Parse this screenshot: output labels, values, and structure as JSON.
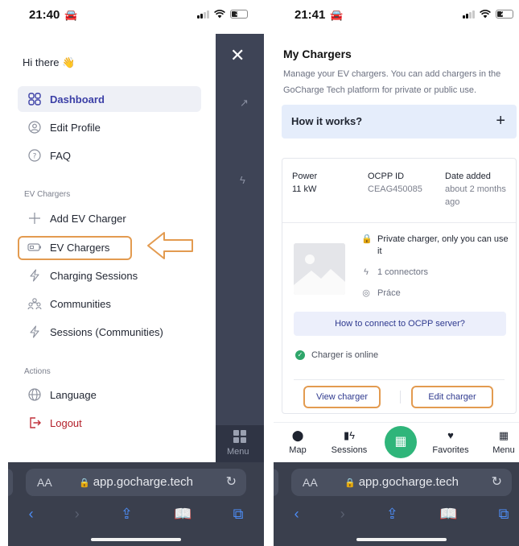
{
  "left": {
    "status": {
      "time": "21:40",
      "battery": "30"
    },
    "greeting": "Hi there",
    "greeting_emoji": "👋",
    "nav": {
      "dashboard": "Dashboard",
      "edit_profile": "Edit Profile",
      "faq": "FAQ"
    },
    "section_ev": "EV Chargers",
    "ev": {
      "add": "Add EV Charger",
      "chargers": "EV Chargers",
      "charging_sessions": "Charging Sessions",
      "communities": "Communities",
      "sessions_communities": "Sessions (Communities)"
    },
    "section_actions": "Actions",
    "actions": {
      "language": "Language",
      "logout": "Logout"
    },
    "menu_label": "Menu",
    "colors": {
      "active": "#3b3fa6",
      "logout": "#b3202a",
      "highlight": "#e39b50"
    }
  },
  "right": {
    "status": {
      "time": "21:41",
      "battery": "29"
    },
    "title": "My Chargers",
    "description": "Manage your EV chargers. You can add chargers in the GoCharge Tech platform for private or public use.",
    "how_it_works": "How it works?",
    "plus": "+",
    "charger": {
      "power_label": "Power",
      "power_value": "11 kW",
      "ocpp_label": "OCPP ID",
      "ocpp_value": "CEAG450085",
      "date_label": "Date added",
      "date_value": "about 2 months ago",
      "private": "Private charger, only you can use it",
      "connectors": "1 connectors",
      "location": "Práce",
      "ocpp_help": "How to connect to OCPP server?",
      "online": "Charger is online",
      "view": "View charger",
      "edit": "Edit charger"
    },
    "tabs": {
      "map": "Map",
      "sessions": "Sessions",
      "favorites": "Favorites",
      "menu": "Menu"
    },
    "colors": {
      "accent": "#2fb57a",
      "info_bg": "#e5edfb",
      "link": "#2f3a8f"
    }
  },
  "browser": {
    "aa": "AA",
    "url": "app.gocharge.tech"
  }
}
